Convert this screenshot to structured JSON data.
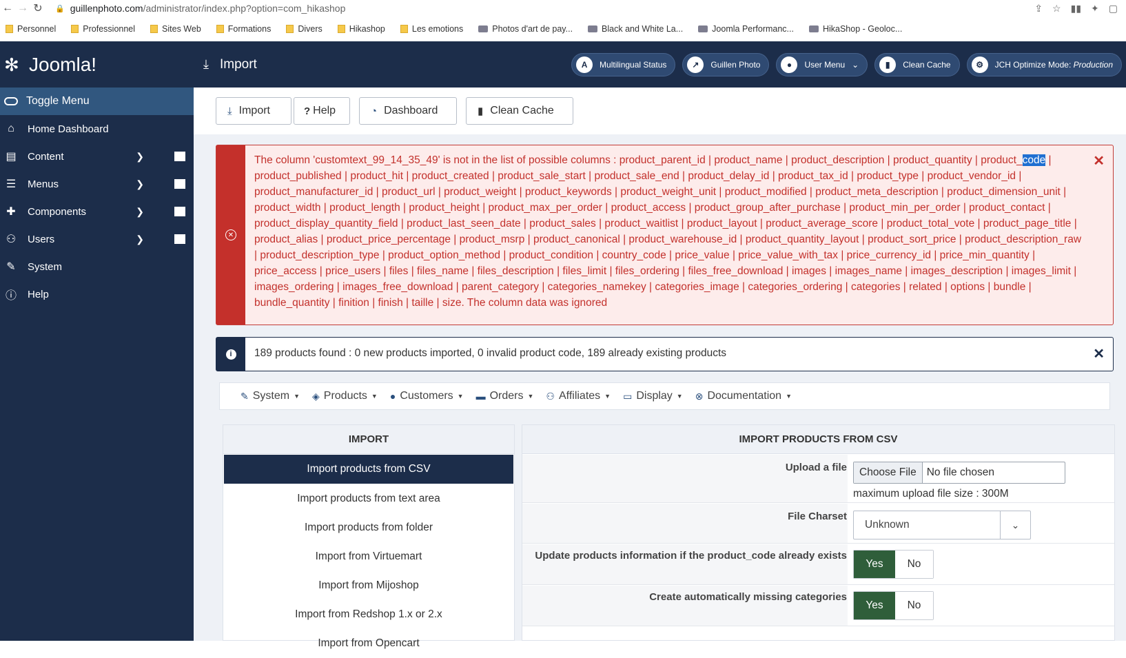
{
  "browser": {
    "url_host": "guillenphoto.com",
    "url_path": "/administrator/index.php?option=com_hikashop",
    "bookmarks": [
      "Personnel",
      "Professionnel",
      "Sites Web",
      "Formations",
      "Divers",
      "Hikashop",
      "Les emotions",
      "Photos d'art de pay...",
      "Black and White La...",
      "Joomla Performanc...",
      "HikaShop - Geoloc..."
    ]
  },
  "sidebar": {
    "logo": "Joomla!",
    "toggle": "Toggle Menu",
    "items": [
      {
        "label": "Home Dashboard",
        "icon": "home-icon"
      },
      {
        "label": "Content",
        "icon": "file-icon"
      },
      {
        "label": "Menus",
        "icon": "list-icon"
      },
      {
        "label": "Components",
        "icon": "puzzle-icon"
      },
      {
        "label": "Users",
        "icon": "users-icon"
      },
      {
        "label": "System",
        "icon": "wrench-icon"
      },
      {
        "label": "Help",
        "icon": "info-icon"
      }
    ]
  },
  "header": {
    "title": "Import",
    "buttons": [
      "Multilingual Status",
      "Guillen Photo",
      "User Menu",
      "Clean Cache"
    ],
    "jch_label": "JCH Optimize Mode: ",
    "jch_mode": "Production"
  },
  "toolbar": {
    "import": "Import",
    "help": "Help",
    "dashboard": "Dashboard",
    "clean_cache": "Clean Cache"
  },
  "error": {
    "before": "The column 'customtext_99_14_35_49' is not in the list of possible columns : product_parent_id | product_name | product_description | product_quantity | product_",
    "highlight": "code",
    "after": " | product_published | product_hit | product_created | product_sale_start | product_sale_end | product_delay_id | product_tax_id | product_type | product_vendor_id | product_manufacturer_id | product_url | product_weight | product_keywords | product_weight_unit | product_modified | product_meta_description | product_dimension_unit | product_width | product_length | product_height | product_max_per_order | product_access | product_group_after_purchase | product_min_per_order | product_contact | product_display_quantity_field | product_last_seen_date | product_sales | product_waitlist | product_layout | product_average_score | product_total_vote | product_page_title | product_alias | product_price_percentage | product_msrp | product_canonical | product_warehouse_id | product_quantity_layout | product_sort_price | product_description_raw | product_description_type | product_option_method | product_condition | country_code | price_value | price_value_with_tax | price_currency_id | price_min_quantity | price_access | price_users | files | files_name | files_description | files_limit | files_ordering | files_free_download | images | images_name | images_description | images_limit | images_ordering | images_free_download | parent_category | categories_namekey | categories_image | categories_ordering | categories | related | options | bundle | bundle_quantity | finition | finish | taille | size. The column data was ignored"
  },
  "info": "189 products found : 0 new products imported, 0 invalid product code, 189 already existing products",
  "menubar": [
    "System",
    "Products",
    "Customers",
    "Orders",
    "Affiliates",
    "Display",
    "Documentation"
  ],
  "import_panel": {
    "title": "IMPORT",
    "items": [
      "Import products from CSV",
      "Import products from text area",
      "Import products from folder",
      "Import from Virtuemart",
      "Import from Mijoshop",
      "Import from Redshop 1.x or 2.x",
      "Import from Opencart"
    ]
  },
  "csv_panel": {
    "title": "IMPORT PRODUCTS FROM CSV",
    "upload_label": "Upload a file",
    "choose_file": "Choose File",
    "no_file": "No file chosen",
    "max_upload": "maximum upload file size : 300M",
    "charset_label": "File Charset",
    "charset_value": "Unknown",
    "update_label": "Update products information if the product_code already exists",
    "create_cat_label": "Create automatically missing categories",
    "yes": "Yes",
    "no": "No"
  }
}
